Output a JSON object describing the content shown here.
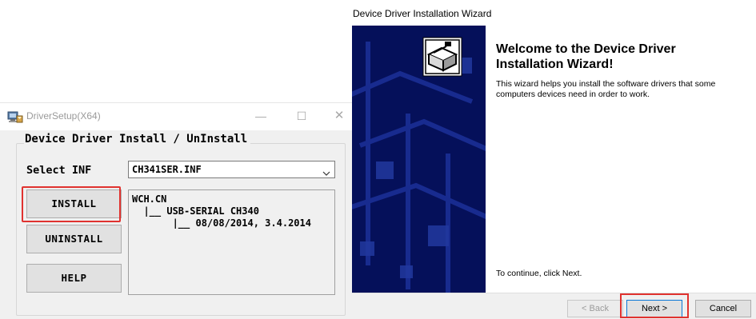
{
  "setup_window": {
    "title": "DriverSetup(X64)",
    "app_icon": "computer-install-icon",
    "controls": {
      "minimize": "—",
      "maximize": "☐",
      "close": "✕"
    },
    "group_title": "Device Driver Install / UnInstall",
    "select_label": "Select INF",
    "select_value": "CH341SER.INF",
    "dropdown_icon": "chevron-down-icon",
    "buttons": {
      "install": "INSTALL",
      "uninstall": "UNINSTALL",
      "help": "HELP"
    },
    "info_lines": [
      "WCH.CN",
      "  |__ USB-SERIAL CH340",
      "       |__ 08/08/2014, 3.4.2014"
    ]
  },
  "wizard": {
    "title": "Device Driver Installation Wizard",
    "heading": "Welcome to the Device Driver Installation Wizard!",
    "description": "This wizard helps you install the software drivers that some computers devices need in order to work.",
    "continue_text": "To continue, click Next.",
    "buttons": {
      "back": "< Back",
      "next": "Next >",
      "cancel": "Cancel"
    },
    "sidebar_icon": "hardware-box-icon"
  },
  "colors": {
    "highlight": "#e0322f",
    "wizard_sidebar": "#05105a",
    "window_bg": "#f0f0f0",
    "focus_border": "#0a78d7"
  }
}
